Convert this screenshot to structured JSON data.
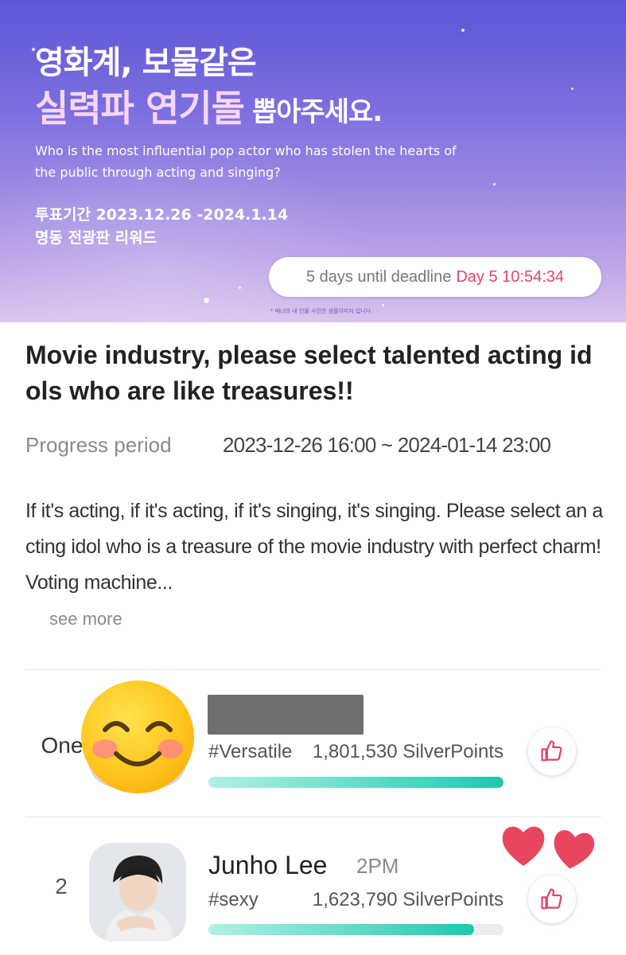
{
  "banner": {
    "headline_line1": "영화계, 보물같은",
    "headline_line2": "실력파 연기돌",
    "headline_line2_suffix": "뽑아주세요.",
    "subtitle": "Who is the most influential pop actor who has stolen the hearts of the public through acting and singing?",
    "vote_period": "투표기간 2023.12.26 -2024.1.14",
    "reward": "명동 전광판 리워드",
    "countdown_label": "5 days until deadline",
    "countdown_value": "Day 5 10:54:34",
    "fineprint": "* 배너의 내 인물 사진은 샘플이미지 입니다."
  },
  "event": {
    "title": "Movie industry, please select talented acting idols who are like treasures!!",
    "period_label": "Progress period",
    "period_value": "2023-12-26 16:00 ~ 2024-01-14 23:00",
    "description": "If it's acting, if it's acting, if it's singing, it's singing. Please select an acting idol who is a treasure of the movie industry with perfect charm! Voting machine...",
    "see_more": "see more"
  },
  "ranking": [
    {
      "rank": "One",
      "name": "",
      "tag": "#Versatile",
      "points": "1,801,530 SilverPoints",
      "progress_fraction": 1.0
    },
    {
      "rank": "2",
      "name": "Junho Lee",
      "group": "2PM",
      "tag": "#sexy",
      "points": "1,623,790 SilverPoints",
      "progress_fraction": 0.901
    }
  ],
  "colors": {
    "accent": "#e0456b",
    "progress": "#1fc6ad",
    "heart": "#e8455f"
  },
  "icons": {
    "vote": "thumbs-up-icon",
    "avatar_overlay": "smiling-face-emoji",
    "sticker": "hearts-sticker"
  }
}
